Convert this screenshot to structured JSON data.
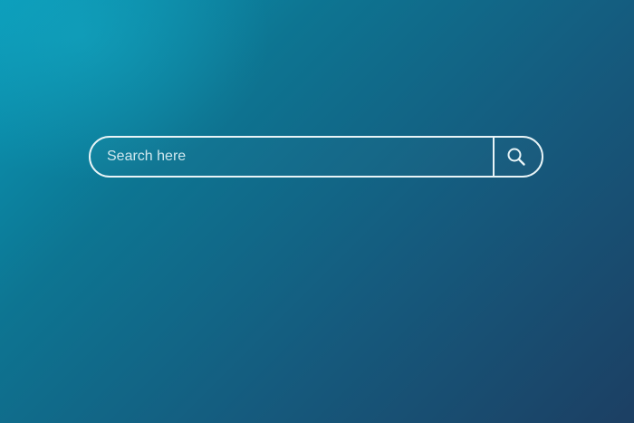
{
  "search": {
    "value": "",
    "placeholder": "Search here",
    "button_icon": "search-icon"
  },
  "colors": {
    "background_top_left": "#0a9ab8",
    "background_bottom_right": "#1c3f63",
    "outline": "#e8f4f7"
  }
}
